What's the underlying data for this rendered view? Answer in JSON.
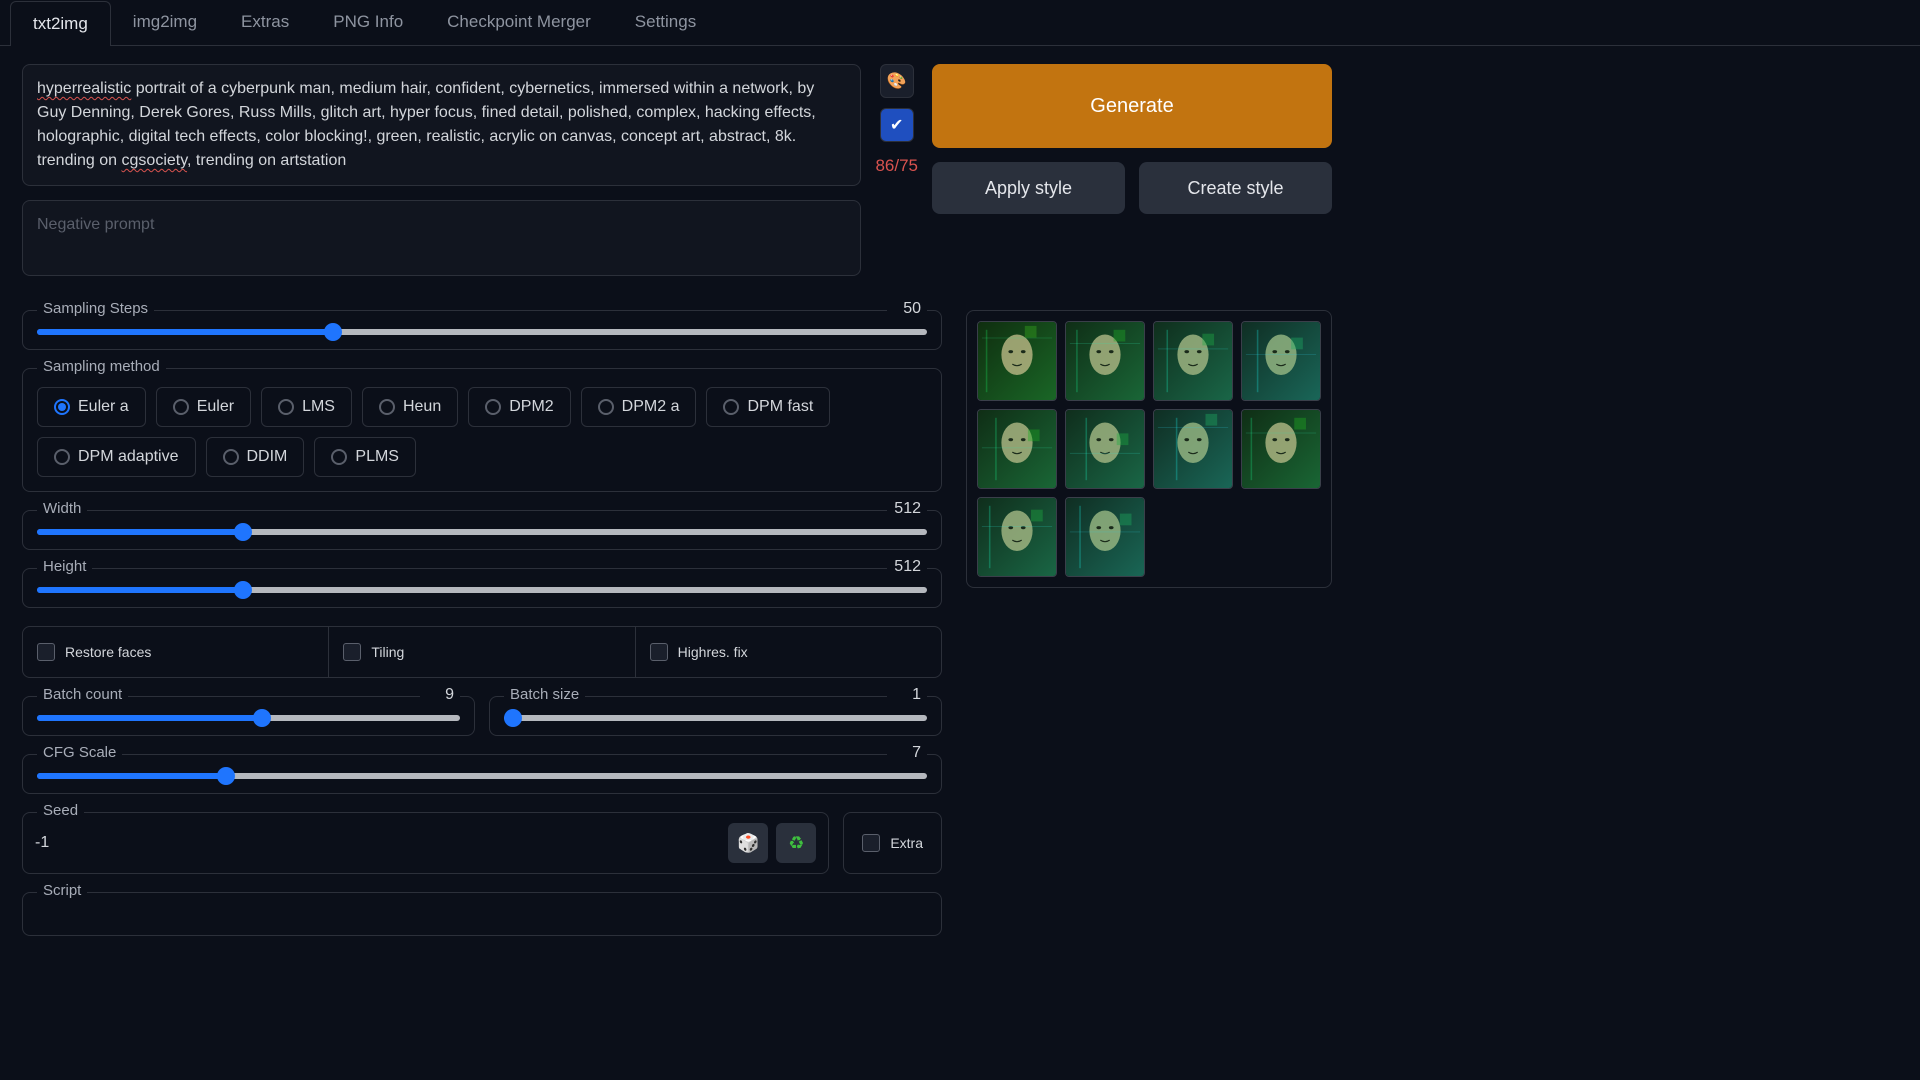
{
  "tabs": [
    "txt2img",
    "img2img",
    "Extras",
    "PNG Info",
    "Checkpoint Merger",
    "Settings"
  ],
  "active_tab": 0,
  "prompt": {
    "text": "hyperrealistic portrait of a cyberpunk man, medium hair, confident, cybernetics, immersed within a network, by Guy Denning, Derek Gores, Russ Mills, glitch art, hyper focus, fined detail, polished, complex, hacking effects, holographic, digital tech effects, color blocking!, green, realistic, acrylic on canvas, concept art, abstract, 8k. trending on cgsociety, trending on artstation",
    "underlined_words": [
      "hyperrealistic",
      "cgsociety"
    ],
    "token_count": "86/75"
  },
  "negative_prompt": {
    "placeholder": "Negative prompt"
  },
  "side_icons": {
    "palette": "🎨",
    "check": "✔"
  },
  "buttons": {
    "generate": "Generate",
    "apply_style": "Apply style",
    "create_style": "Create style"
  },
  "sampling_steps": {
    "label": "Sampling Steps",
    "value": 50,
    "min": 1,
    "max": 150,
    "fill_pct": 34
  },
  "sampling_method": {
    "label": "Sampling method",
    "options": [
      "Euler a",
      "Euler",
      "LMS",
      "Heun",
      "DPM2",
      "DPM2 a",
      "DPM fast",
      "DPM adaptive",
      "DDIM",
      "PLMS"
    ],
    "selected": 0
  },
  "width": {
    "label": "Width",
    "value": 512,
    "min": 64,
    "max": 2048,
    "fill_pct": 23
  },
  "height": {
    "label": "Height",
    "value": 512,
    "min": 64,
    "max": 2048,
    "fill_pct": 23
  },
  "checks": {
    "restore_faces": {
      "label": "Restore faces",
      "checked": false
    },
    "tiling": {
      "label": "Tiling",
      "checked": false
    },
    "highres_fix": {
      "label": "Highres. fix",
      "checked": false
    }
  },
  "batch_count": {
    "label": "Batch count",
    "value": 9,
    "min": 1,
    "max": 16,
    "fill_pct": 53
  },
  "batch_size": {
    "label": "Batch size",
    "value": 1,
    "min": 1,
    "max": 8,
    "fill_pct": 0
  },
  "cfg_scale": {
    "label": "CFG Scale",
    "value": 7,
    "min": 1,
    "max": 30,
    "fill_pct": 21
  },
  "seed": {
    "label": "Seed",
    "value": "-1",
    "dice_icon": "🎲",
    "recycle_icon": "♻",
    "extra_label": "Extra",
    "extra_checked": false
  },
  "script": {
    "label": "Script"
  },
  "gallery": {
    "count": 10
  }
}
